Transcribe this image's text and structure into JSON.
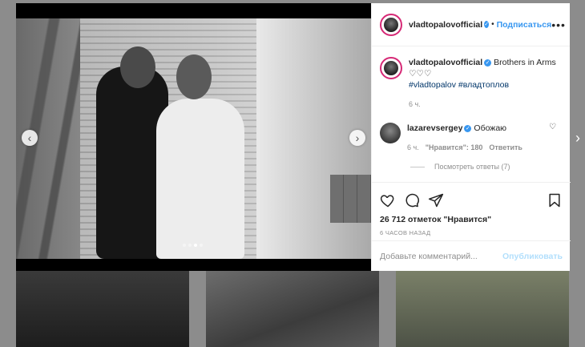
{
  "post": {
    "author": "vladtopalovofficial",
    "follow_label": "Подписаться",
    "more_glyph": "•••",
    "caption_text": "Brothers in Arms ♡♡♡",
    "hashtag_1": "#vladtopalov",
    "hashtag_2": "#владтоплов",
    "caption_time": "6 ч.",
    "likes": "26 712 отметок \"Нравится\"",
    "time_ago": "6 ЧАСОВ НАЗАД"
  },
  "comment": {
    "author": "lazarevsergey",
    "text": "Обожаю",
    "time": "6 ч.",
    "likes": "\"Нравится\": 180",
    "reply_label": "Ответить",
    "view_replies": "Посмотреть ответы (7)"
  },
  "composer": {
    "placeholder": "Добавьте комментарий...",
    "publish_label": "Опубликовать"
  },
  "carousel": {
    "prev_glyph": "‹",
    "next_glyph": "›",
    "total_slides": 4,
    "active_slide": 3
  },
  "modal": {
    "next_post_glyph": "›"
  },
  "colors": {
    "accent": "#3897f0",
    "publish_disabled": "#b2dffc",
    "hashtag": "#003569"
  }
}
